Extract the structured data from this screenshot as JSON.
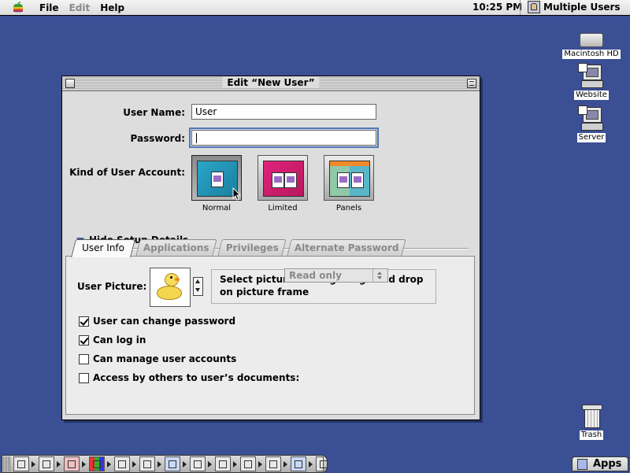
{
  "menubar": {
    "items": [
      {
        "label": "File",
        "enabled": true
      },
      {
        "label": "Edit",
        "enabled": false
      },
      {
        "label": "Help",
        "enabled": true
      }
    ],
    "clock": "10:25 PM",
    "active_app": "Multiple Users",
    "active_app_icon": "multiple-users-icon"
  },
  "desktop": {
    "icons": [
      {
        "label": "Macintosh HD",
        "icon": "hard-drive-icon"
      },
      {
        "label": "Website",
        "icon": "shared-computer-icon"
      },
      {
        "label": "Server",
        "icon": "shared-computer-icon"
      },
      {
        "label": "Trash",
        "icon": "trash-icon"
      }
    ]
  },
  "window": {
    "title": "Edit “New User”",
    "user_name_label": "User Name:",
    "user_name_value": "User",
    "password_label": "Password:",
    "password_value": "",
    "kind_label": "Kind of User Account:",
    "account_kinds": [
      {
        "label": "Normal",
        "selected": true
      },
      {
        "label": "Limited",
        "selected": false
      },
      {
        "label": "Panels",
        "selected": false
      }
    ],
    "disclosure_label": "Hide Setup Details",
    "tabs": [
      {
        "label": "User Info",
        "active": true
      },
      {
        "label": "Applications",
        "active": false
      },
      {
        "label": "Privileges",
        "active": false
      },
      {
        "label": "Alternate Password",
        "active": false
      }
    ],
    "user_info": {
      "picture_label": "User Picture:",
      "picture_icon": "rubber-duck-icon",
      "picture_help": "Select picture or drag image and drop on picture frame",
      "checkboxes": [
        {
          "label": "User can change password",
          "checked": true
        },
        {
          "label": "Can log in",
          "checked": true
        },
        {
          "label": "Can manage user accounts",
          "checked": false
        },
        {
          "label": "Access by others to user’s documents:",
          "checked": false
        }
      ],
      "access_popup_value": "Read only",
      "access_popup_enabled": false
    }
  },
  "dock": {
    "apps_label": "Apps"
  },
  "colors": {
    "desktop": "#3a4f94",
    "focus_ring": "#4f77b9"
  }
}
